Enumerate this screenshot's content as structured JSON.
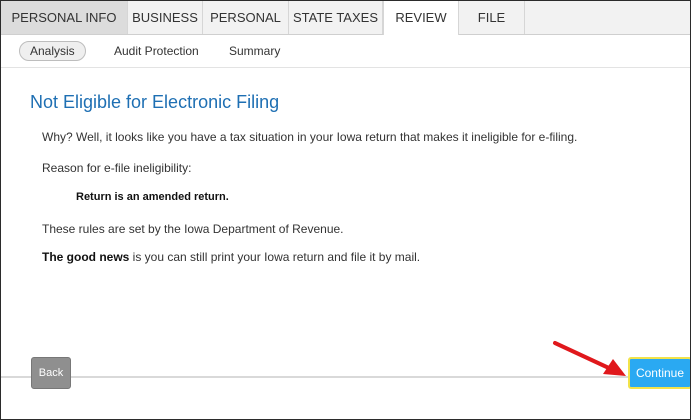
{
  "tabs": [
    {
      "label": "PERSONAL INFO"
    },
    {
      "label": "BUSINESS"
    },
    {
      "label": "PERSONAL"
    },
    {
      "label": "STATE TAXES"
    },
    {
      "label": "REVIEW"
    },
    {
      "label": "FILE"
    }
  ],
  "subtabs": [
    {
      "label": "Analysis"
    },
    {
      "label": "Audit Protection"
    },
    {
      "label": "Summary"
    }
  ],
  "content": {
    "title": "Not Eligible for Electronic Filing",
    "why_text": "Why? Well, it looks like you have a tax situation in your Iowa return that makes it ineligible for e-filing.",
    "reason_label": "Reason for e-file ineligibility:",
    "reason_value": "Return is an amended return.",
    "rules_text": "These rules are set by the Iowa Department of Revenue.",
    "good_news_bold": "The good news",
    "good_news_rest": " is you can still print your Iowa return and file it by mail."
  },
  "footer": {
    "back_label": "Back",
    "continue_label": "Continue"
  },
  "colors": {
    "title": "#1e6fb3",
    "continue_bg": "#2aa9f2",
    "continue_outline": "#f2e34a",
    "annotation_arrow": "#e0181c"
  }
}
